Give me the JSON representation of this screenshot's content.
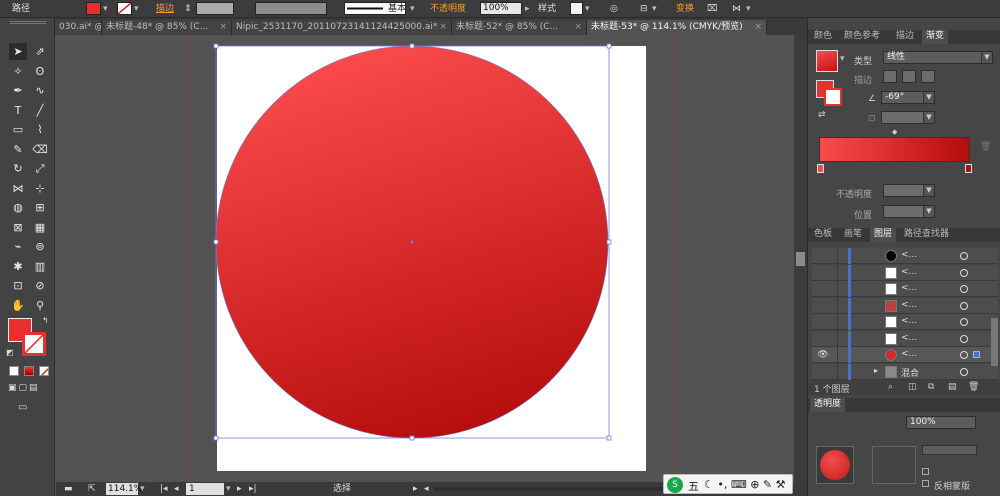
{
  "control_bar": {
    "object_type": "路径",
    "stroke_label": "描边",
    "stroke_profile": "基本",
    "opacity_label": "不透明度",
    "opacity_value": "100%",
    "style_label": "样式",
    "transform_label": "变换"
  },
  "tabs": [
    {
      "label": "030.ai* @ ...",
      "active": false
    },
    {
      "label": "未标题-48* @ 85% (C...",
      "active": false
    },
    {
      "label": "Nipic_2531170_20110723141124425000.ai*",
      "active": false
    },
    {
      "label": "未标题-52* @ 85% (C...",
      "active": false
    },
    {
      "label": "未标题-53* @ 114.1% (CMYK/预览)",
      "active": true
    }
  ],
  "tools": [
    "selection-tool",
    "direct-selection-tool",
    "magic-wand-tool",
    "lasso-tool",
    "pen-tool",
    "curvature-tool",
    "type-tool",
    "line-segment-tool",
    "rectangle-tool",
    "paintbrush-tool",
    "pencil-tool",
    "eraser-tool",
    "rotate-tool",
    "scale-tool",
    "width-tool",
    "free-transform-tool",
    "shape-builder-tool",
    "perspective-grid-tool",
    "mesh-tool",
    "gradient-tool",
    "eyedropper-tool",
    "blend-tool",
    "symbol-sprayer-tool",
    "column-graph-tool",
    "artboard-tool",
    "slice-tool",
    "hand-tool",
    "zoom-tool"
  ],
  "colors": {
    "fill": "#e8302e",
    "gradient_start": "#fb4b4b",
    "gradient_end": "#b50c0c",
    "guide": "#b84040",
    "selection": "#6b7fd8"
  },
  "gradient_panel": {
    "tabs": [
      "颜色",
      "颜色参考",
      "描边",
      "渐变"
    ],
    "active_tab": "渐变",
    "type_label": "类型",
    "type_value": "线性",
    "stroke_label": "描边",
    "angle_value": "-69°",
    "opacity_label": "不透明度",
    "position_label": "位置"
  },
  "layers_panel": {
    "tabs": [
      "色板",
      "画笔",
      "图层",
      "路径查找器"
    ],
    "active_tab": "图层",
    "rows": [
      {
        "name": "<...",
        "thumb": "#000000"
      },
      {
        "name": "<...",
        "thumb": "#ffffff"
      },
      {
        "name": "<...",
        "thumb": "#ffffff"
      },
      {
        "name": "<...",
        "thumb": "#c04040"
      },
      {
        "name": "<...",
        "thumb": "#ffffff"
      },
      {
        "name": "<...",
        "thumb": "#ffffff"
      },
      {
        "name": "<...",
        "thumb": "#d62a2a"
      },
      {
        "name": "混合",
        "thumb": "#8a8a8a"
      }
    ],
    "layer_count": "1 个图层"
  },
  "transparency_panel": {
    "tab": "透明度",
    "opacity_value": "100%",
    "mask_label": "反相蒙版"
  },
  "status_bar": {
    "zoom": "114.1%",
    "artboard": "1",
    "tool": "选择"
  },
  "ime": {
    "label": "五"
  }
}
